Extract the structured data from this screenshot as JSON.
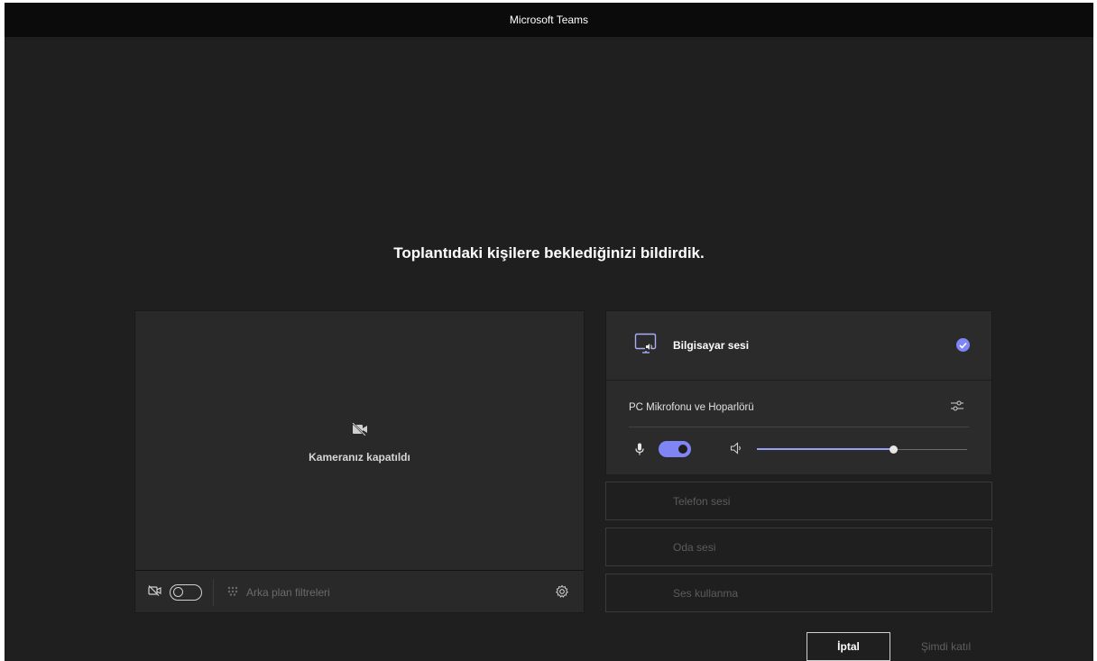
{
  "window": {
    "title": "Microsoft Teams"
  },
  "lobby": {
    "message": "Toplantıdaki kişilere beklediğinizi bildirdik."
  },
  "video": {
    "camera_off_text": "Kameranız kapatıldı",
    "camera_toggle_on": false,
    "background_filters_label": "Arka plan filtreleri"
  },
  "audio": {
    "selected_option": "Bilgisayar sesi",
    "device_name": "PC Mikrofonu ve Hoparlörü",
    "mic_on": true,
    "volume_level": 0.65,
    "other_options": [
      "Telefon sesi",
      "Oda sesi",
      "Ses kullanma"
    ]
  },
  "actions": {
    "cancel_label": "İptal",
    "join_label": "Şimdi katıl"
  },
  "colors": {
    "accent": "#7f85f5",
    "background": "#1f1f1f",
    "titlebar": "#0b0b0b"
  },
  "icons": {
    "camera_off": "camera-off-icon",
    "background": "background-filter-icon",
    "settings": "gear-icon",
    "computer_audio": "computer-audio-icon",
    "check": "checkmark-icon",
    "device_settings": "sliders-icon",
    "mic": "microphone-icon",
    "speaker": "speaker-icon"
  }
}
